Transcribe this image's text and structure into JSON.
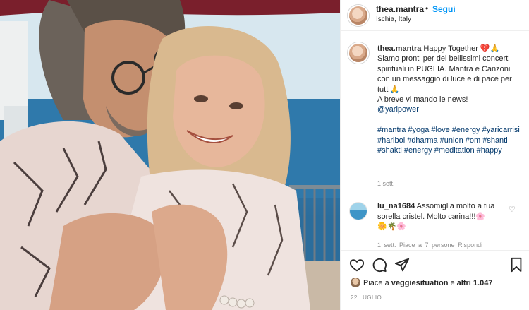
{
  "post": {
    "username": "thea.mantra",
    "follow_label": "Segui",
    "location": "Ischia, Italy"
  },
  "caption": {
    "username": "thea.mantra",
    "line1": " Happy Together 💔🙏",
    "body": "Siamo pronti per dei bellissimi concerti spirituali in PUGLIA. Mantra e Canzoni con un messaggio di luce e di pace per tutti🙏\nA breve vi mando le news!\n",
    "mention": "@yaripower",
    "hashtags": "#mantra #yoga #love #energy #yaricarrisi #haribol #dharma #union #om #shanti #shakti #energy #meditation #happy",
    "time": "1 sett."
  },
  "comment": {
    "username": "lu_na1684",
    "text": " Assomiglia molto a tua sorella cristel. Molto carina!!!🌸",
    "emoji_line": "🌼🌴🌸",
    "meta": "1 sett.   Piace a 7 persone   Rispondi"
  },
  "likes": {
    "prefix": "Piace a ",
    "user": "veggiesituation",
    "middle": " e ",
    "others": "altri 1.047"
  },
  "date": "22 LUGLIO",
  "icons": [
    "heart-icon",
    "comment-icon",
    "share-icon",
    "bookmark-icon",
    "small-heart-icon"
  ],
  "colors": {
    "link": "#0095f6",
    "hashtag": "#00376b",
    "muted": "#8e8e8e"
  }
}
